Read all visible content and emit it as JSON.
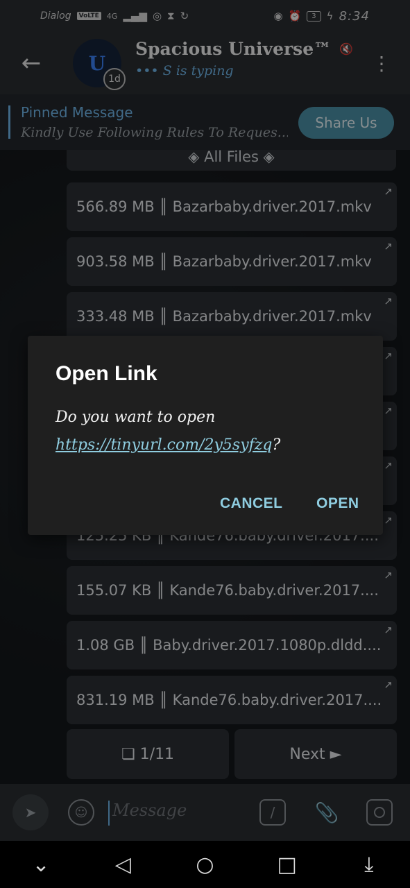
{
  "status_bar": {
    "carrier": "Dialog",
    "volte": "VoLTE",
    "network": "4G",
    "battery": "3",
    "time": "8:34"
  },
  "header": {
    "avatar_letter": "U",
    "avatar_badge": "1d",
    "title": "Spacious Universe™",
    "subtitle": "••• S is typing"
  },
  "pinned": {
    "title": "Pinned Message",
    "text": "Kindly Use Following Rules To Reques...",
    "button": "Share Us"
  },
  "chat": {
    "header_label": "◈ All Files ◈",
    "files": [
      "566.89 MB ║ Bazarbaby.driver.2017.mkv",
      "903.58 MB ║ Bazarbaby.driver.2017.mkv",
      "333.48 MB ║ Bazarbaby.driver.2017.mkv",
      "",
      "",
      "",
      "125.25 KB ║ Kande76.baby.driver.2017....",
      "155.07 KB ║ Kande76.baby.driver.2017....",
      "1.08 GB ║ Baby.driver.2017.1080p.dldd....",
      "831.19 MB ║ Kande76.baby.driver.2017...."
    ],
    "page_indicator": "❏ 1/11",
    "next_label": "Next ►"
  },
  "input": {
    "placeholder": "Message"
  },
  "dialog": {
    "title": "Open Link",
    "prompt": "Do you want to open",
    "link": "https://tinyurl.com/2y5syfzq",
    "suffix": "?",
    "cancel": "CANCEL",
    "open": "OPEN"
  }
}
